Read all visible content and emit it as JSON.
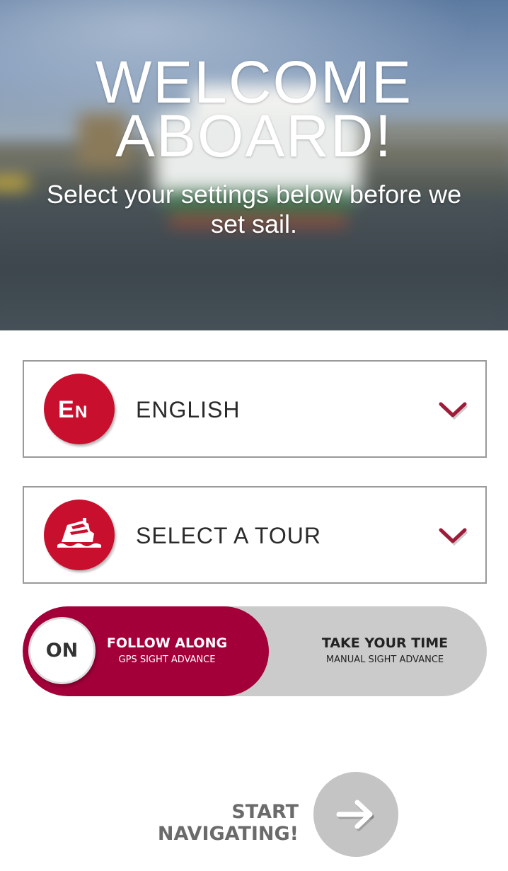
{
  "hero": {
    "title_line1": "WELCOME",
    "title_line2": "ABOARD!",
    "subtitle": "Select your settings below before we set sail."
  },
  "language_select": {
    "badge_text": "EN",
    "label": "ENGLISH",
    "icon": "language-badge-icon"
  },
  "tour_select": {
    "label": "SELECT A TOUR",
    "icon": "ship-icon"
  },
  "mode_toggle": {
    "knob_label": "ON",
    "selected": "follow",
    "follow": {
      "title": "FOLLOW ALONG",
      "subtitle": "GPS SIGHT ADVANCE"
    },
    "take": {
      "title": "TAKE YOUR TIME",
      "subtitle": "MANUAL SIGHT ADVANCE"
    }
  },
  "start": {
    "label": "START NAVIGATING!",
    "icon": "arrow-right-icon"
  },
  "colors": {
    "brand_red": "#c8102e",
    "toggle_active": "#a30039",
    "toggle_track": "#cbcbcb",
    "button_gray": "#c4c4c4"
  }
}
